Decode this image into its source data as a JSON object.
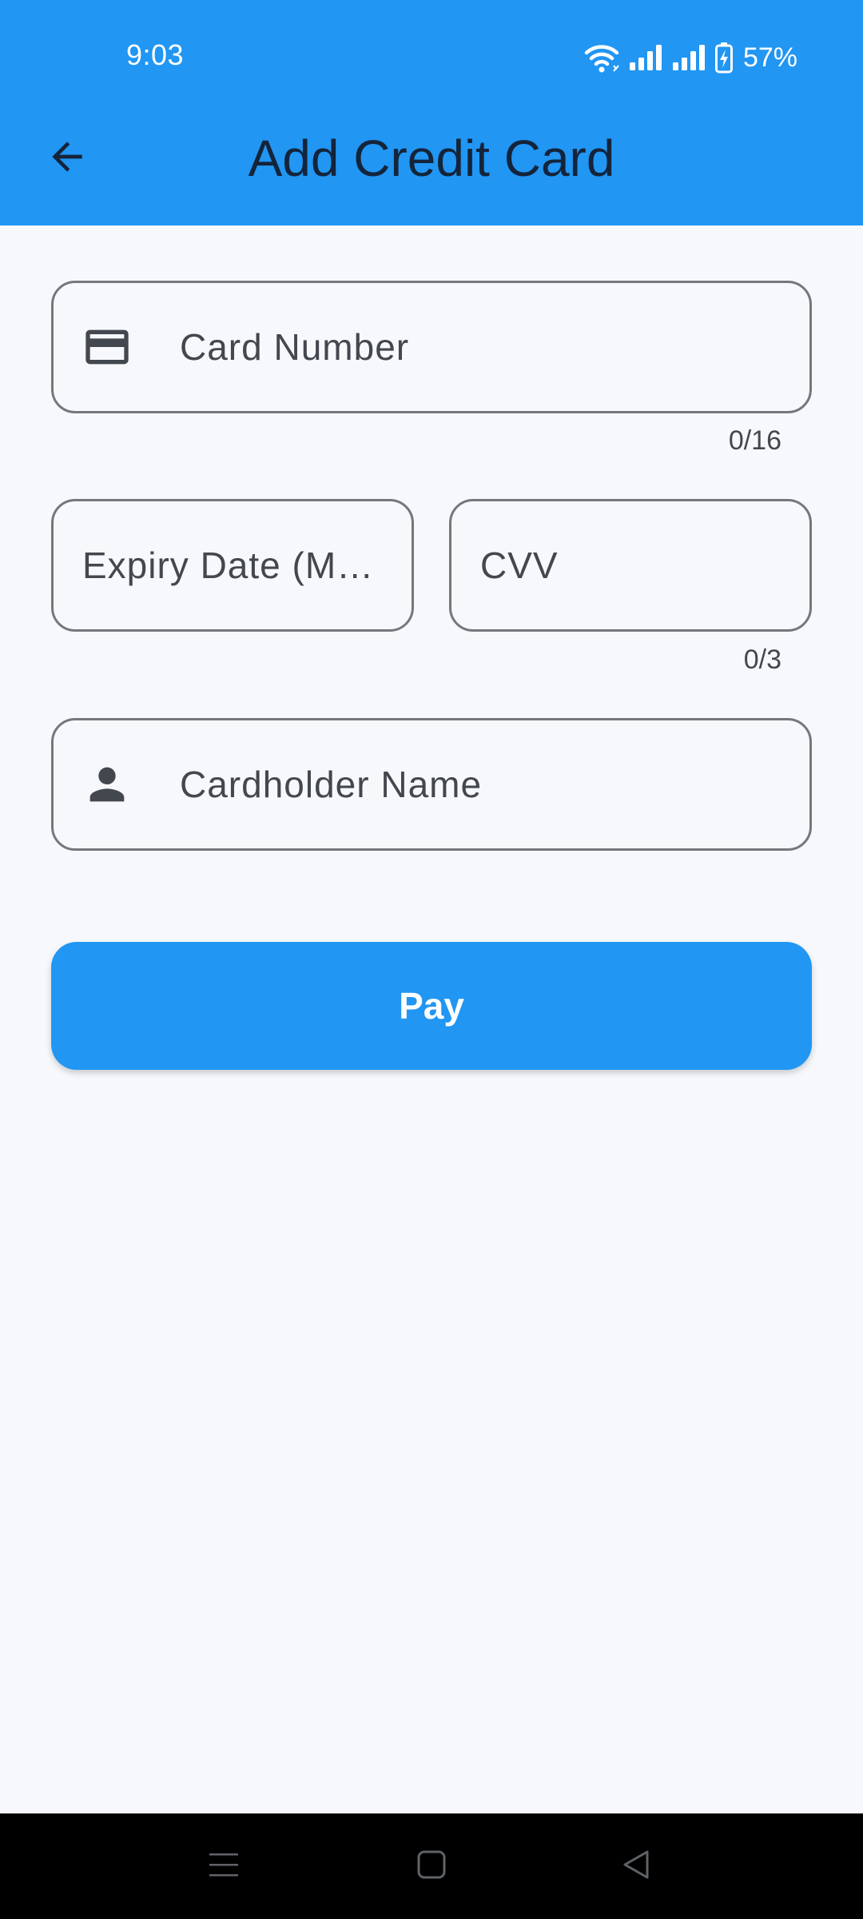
{
  "status_bar": {
    "time": "9:03",
    "battery_percent": "57%",
    "icons": [
      "wifi-icon",
      "signal-icon",
      "signal-icon",
      "battery-charging-icon"
    ]
  },
  "app_bar": {
    "title": "Add Credit Card",
    "back_icon": "arrow-back-icon"
  },
  "form": {
    "card_number": {
      "placeholder": "Card Number",
      "value": "",
      "icon": "credit-card-icon",
      "counter": "0/16"
    },
    "expiry_date": {
      "placeholder": "Expiry Date (M…",
      "value": ""
    },
    "cvv": {
      "placeholder": "CVV",
      "value": "",
      "counter": "0/3"
    },
    "cardholder_name": {
      "placeholder": "Cardholder Name",
      "value": "",
      "icon": "person-icon"
    },
    "pay_label": "Pay"
  },
  "nav_bar": {
    "icons": [
      "menu-icon",
      "home-icon",
      "back-triangle-icon"
    ]
  },
  "colors": {
    "primary": "#2196f3",
    "background": "#f6f8fc",
    "title_text": "#14243a",
    "field_border": "#75777b",
    "field_text": "#43474e"
  }
}
